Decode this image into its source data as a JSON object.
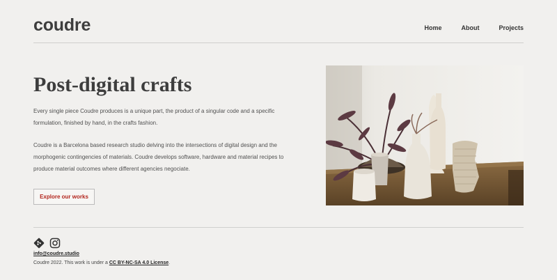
{
  "header": {
    "logo": "coudre",
    "nav": [
      "Home",
      "About",
      "Projects"
    ]
  },
  "hero": {
    "title": "Post-digital crafts",
    "paragraph1": "Every single piece Coudre produces is a unique part, the product of a singular code and a specific formulation, finished by hand, in the crafts fashion.",
    "paragraph2": "Coudre is a Barcelona based research studio delving into the intersections of digital design and the morphogenic contingencies of materials. Coudre develops software, hardware and material recipes to produce material outcomes where different agencies negociate.",
    "cta": "Explore our works"
  },
  "footer": {
    "social_icons": [
      "git-icon",
      "instagram-icon"
    ],
    "email": "info@coudre.studio",
    "copyright_prefix": "Coudre 2022. This work is under a ",
    "license": "CC BY-NC-SA 4.0 License",
    "copyright_suffix": "."
  },
  "colors": {
    "background": "#f1f0ee",
    "cta_text": "#b3261e",
    "text": "#444444"
  }
}
